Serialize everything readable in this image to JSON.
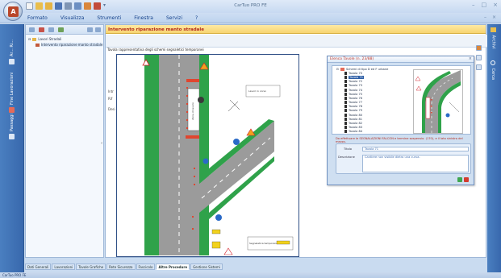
{
  "window": {
    "title": "CarTuo PRO FE",
    "controls": [
      "–",
      "□",
      "×"
    ]
  },
  "menu": {
    "items": [
      "Formato",
      "Visualizza",
      "Strumenti",
      "Finestra",
      "Servizi",
      "?"
    ]
  },
  "left_sidebar": {
    "tabs": [
      "Ar... Ri...",
      "Fine Lavorazioni",
      "Passaggi"
    ]
  },
  "right_sidebar": {
    "tabs": [
      "Archivi",
      "Cerca"
    ]
  },
  "tree": {
    "rows": [
      {
        "label": "Lavori Stradali",
        "level": 0
      },
      {
        "label": "Intervento riparazione manto stradale",
        "level": 1
      }
    ]
  },
  "main": {
    "banner": "Intervento riparazione manto stradale",
    "caption": "Tavola rappresentativa degli schemi segnaletici temporanei",
    "ghost_labels": [
      "Intr",
      "Rif",
      "Desi"
    ]
  },
  "float_window": {
    "title": "Elenco Tavole (n. 23/88)",
    "parent_node": "Schemi di tipo D ed F urbane",
    "items": [
      "Tavola 70",
      "Tavola 71",
      "Tavola 72",
      "Tavola 73",
      "Tavola 74",
      "Tavola 75",
      "Tavola 76",
      "Tavola 77",
      "Tavola 78",
      "Tavola 79",
      "Tavola 80",
      "Tavola 81",
      "Tavola 82",
      "Tavola 83",
      "Tavola 84"
    ],
    "selected": "Tavola 71",
    "note": "Da effettuare le SEGNALAZIONI FALCON e termine sospensio. (170), e il lato sinistro del mezzo.",
    "title_label": "Titolo",
    "title_value": "Tavola 71",
    "desc_label": "Descrizione",
    "desc_value": "Cantiere non visibile dietro una curva."
  },
  "bottom_tabs": {
    "items": [
      "Dati Generali",
      "Lavorazioni",
      "Tavole Grafiche",
      "Rete Sicurezza",
      "Fascicolo",
      "Altre Procedure",
      "Gestione Sistemi"
    ],
    "active": "Altre Procedure"
  },
  "status": {
    "text": "CarTuo PRO FE"
  },
  "drawing_labels": {
    "zone": "Zona di lavoro",
    "legend_top": "Lavori in corso",
    "legend_bottom": "Segnaletica temporanea"
  }
}
